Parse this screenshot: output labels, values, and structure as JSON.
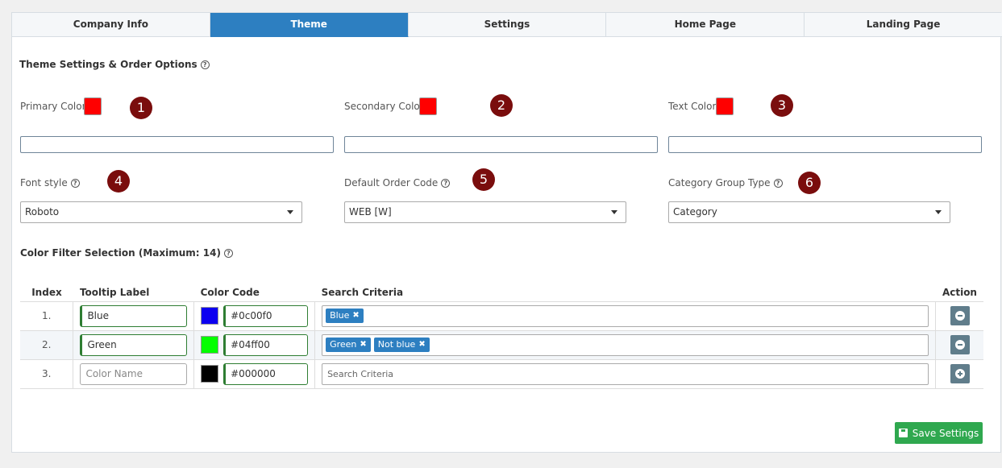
{
  "tabs": [
    {
      "label": "Company Info",
      "active": false
    },
    {
      "label": "Theme",
      "active": true
    },
    {
      "label": "Settings",
      "active": false
    },
    {
      "label": "Home Page",
      "active": false
    },
    {
      "label": "Landing Page",
      "active": false
    }
  ],
  "theme_section": {
    "title": "Theme Settings & Order Options",
    "help_icon": "question-circle-icon"
  },
  "colors": {
    "primary_label": "Primary Color",
    "primary_value": "#ff0000",
    "secondary_label": "Secondary Color",
    "secondary_value": "#ff0000",
    "text_label": "Text Color",
    "text_value": "#ff0000"
  },
  "markers": [
    "1",
    "2",
    "3",
    "4",
    "5",
    "6"
  ],
  "font_style": {
    "label": "Font style",
    "value": "Roboto"
  },
  "default_order_code": {
    "label": "Default Order Code",
    "value": "WEB [W]"
  },
  "category_group_type": {
    "label": "Category Group Type",
    "value": "Category"
  },
  "filter_section": {
    "title": "Color Filter Selection (Maximum: 14)"
  },
  "table": {
    "headers": {
      "index": "Index",
      "tooltip": "Tooltip Label",
      "color_code": "Color Code",
      "search": "Search Criteria",
      "action": "Action"
    },
    "rows": [
      {
        "index": "1.",
        "tooltip": "Blue",
        "color": "#0c00f0",
        "code": "#0c00f0",
        "tags": [
          "Blue"
        ],
        "action": "remove"
      },
      {
        "index": "2.",
        "tooltip": "Green",
        "color": "#04ff00",
        "code": "#04ff00",
        "tags": [
          "Green",
          "Not blue"
        ],
        "action": "remove"
      },
      {
        "index": "3.",
        "tooltip_placeholder": "Color Name",
        "color": "#000000",
        "code": "#000000",
        "search_placeholder": "Search Criteria",
        "action": "add"
      }
    ]
  },
  "save_button": {
    "label": "Save Settings",
    "icon": "floppy-disk-icon",
    "color": "#2fa84f"
  },
  "accent_color": "#2d7fc1"
}
